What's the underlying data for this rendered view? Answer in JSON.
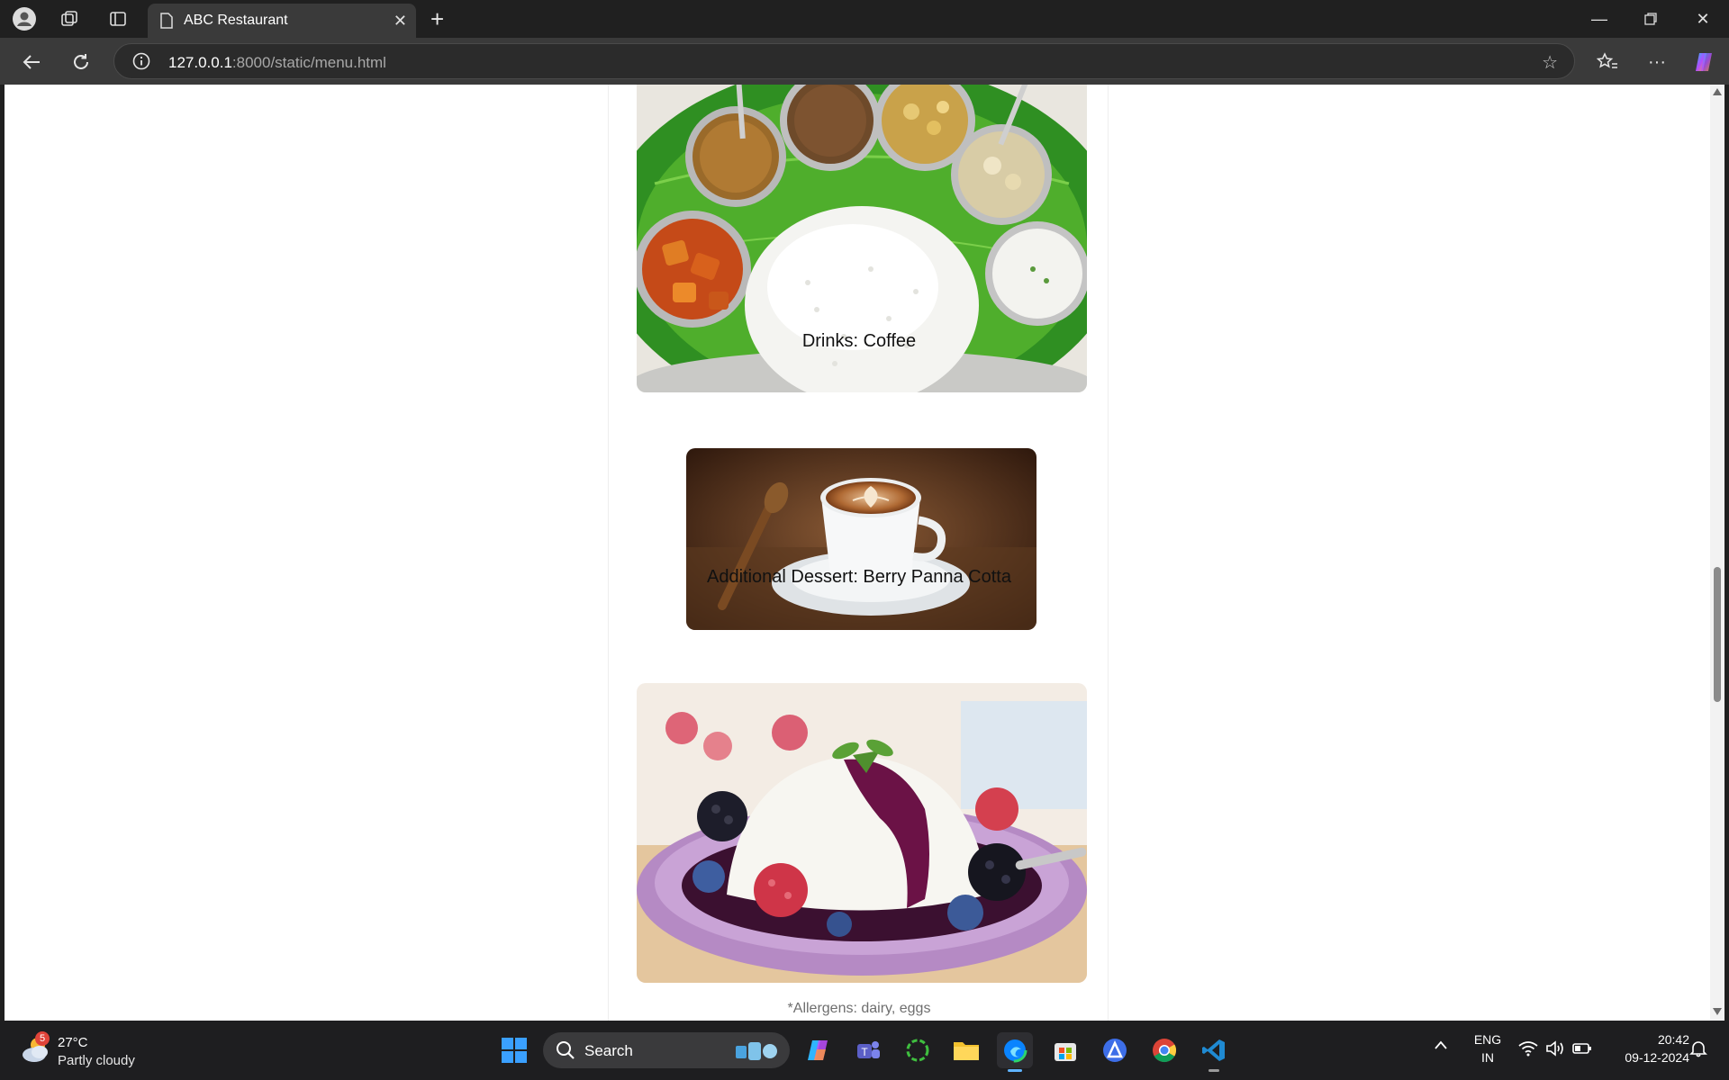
{
  "browser": {
    "tab_title": "ABC Restaurant",
    "url_host": "127.0.0.1",
    "url_path": ":8000/static/menu.html"
  },
  "menu": {
    "drinks_caption": "Drinks: Coffee",
    "dessert_caption": "Additional Dessert: Berry Panna Cotta",
    "allergens": "*Allergens: dairy, eggs"
  },
  "taskbar": {
    "weather_badge": "5",
    "temperature": "27°C",
    "weather": "Partly cloudy",
    "search_label": "Search",
    "lang_line1": "ENG",
    "lang_line2": "IN",
    "time": "20:42",
    "date": "09-12-2024"
  },
  "colors": {
    "accent_edge": "#0a84ff",
    "vscode": "#1f8ad2",
    "taskbar_bg": "#1e1e20"
  }
}
